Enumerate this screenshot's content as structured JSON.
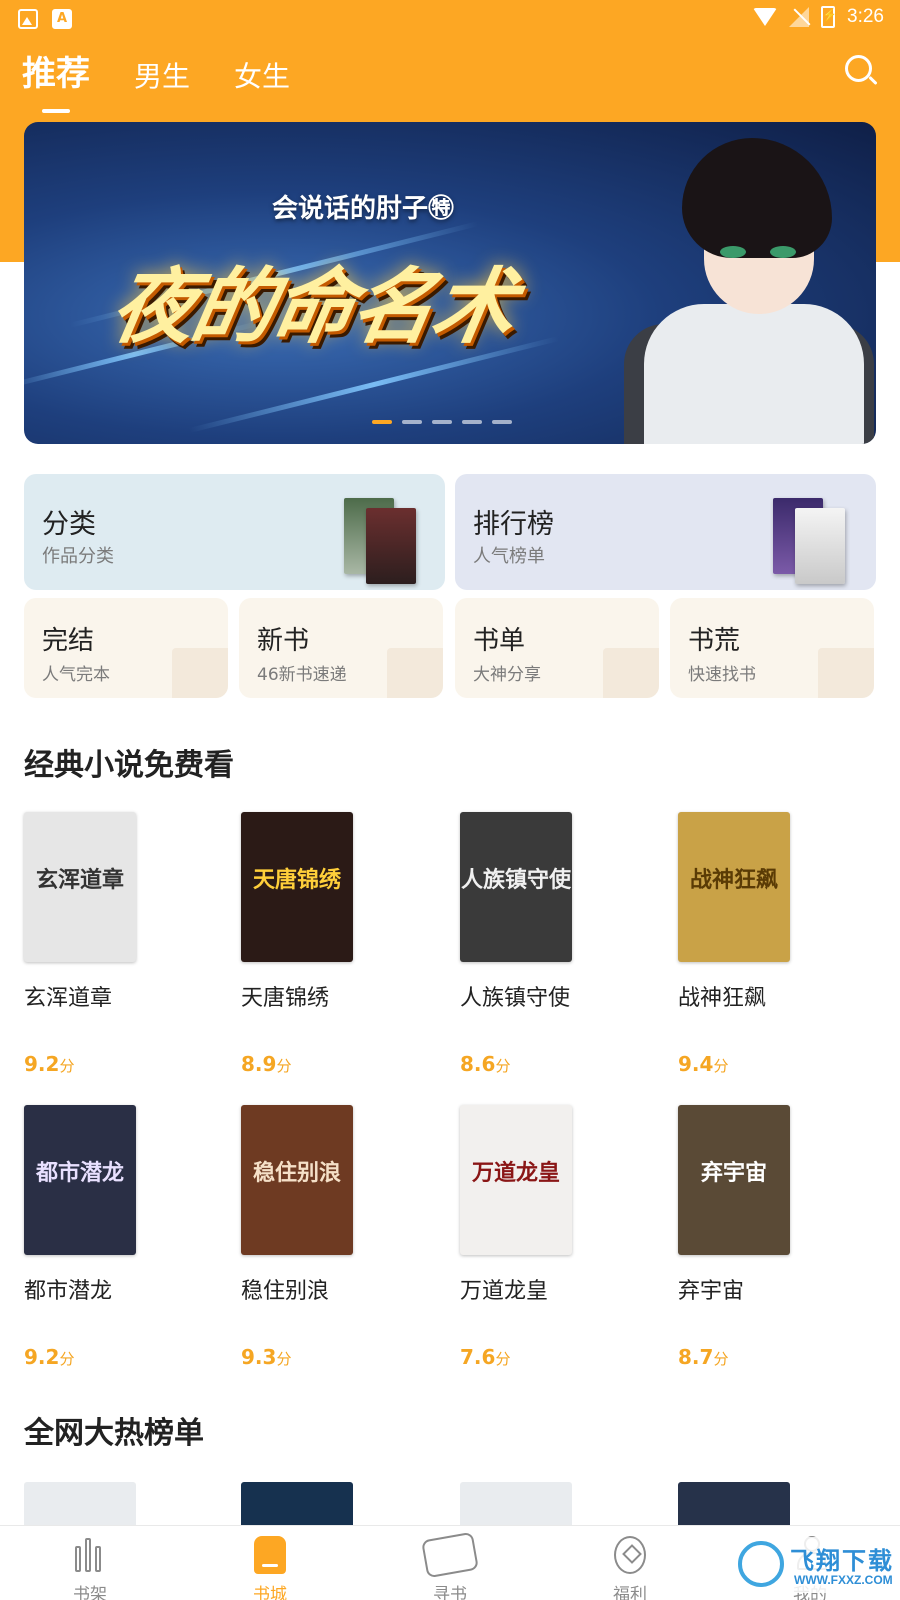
{
  "status_bar": {
    "time": "3:26",
    "notif_icon_letter": "A"
  },
  "header": {
    "tabs": [
      {
        "label": "推荐",
        "active": true
      },
      {
        "label": "男生",
        "active": false
      },
      {
        "label": "女生",
        "active": false
      }
    ],
    "search_icon": "search-icon"
  },
  "banner": {
    "author": "会说话的肘子㊕",
    "title": "夜的命名术",
    "slide_count": 5,
    "active_slide": 1
  },
  "quick_entries": {
    "large": [
      {
        "title": "分类",
        "subtitle": "作品分类"
      },
      {
        "title": "排行榜",
        "subtitle": "人气榜单"
      }
    ],
    "small": [
      {
        "title": "完结",
        "subtitle": "人气完本"
      },
      {
        "title": "新书",
        "subtitle": "46新书速递"
      },
      {
        "title": "书单",
        "subtitle": "大神分享"
      },
      {
        "title": "书荒",
        "subtitle": "快速找书"
      }
    ]
  },
  "sections": {
    "classics": {
      "title": "经典小说免费看",
      "books": [
        {
          "name": "玄浑道章",
          "score": "9.2",
          "unit": "分",
          "cover_text": "玄浑道章",
          "cover_bg": "#e6e6e6",
          "cover_fg": "#333333"
        },
        {
          "name": "天唐锦绣",
          "score": "8.9",
          "unit": "分",
          "cover_text": "天唐锦绣",
          "cover_bg": "#2b1a16",
          "cover_fg": "#ffcf3a"
        },
        {
          "name": "人族镇守使",
          "score": "8.6",
          "unit": "分",
          "cover_text": "人族镇守使",
          "cover_bg": "#3a3a3a",
          "cover_fg": "#f0f0f0"
        },
        {
          "name": "战神狂飙",
          "score": "9.4",
          "unit": "分",
          "cover_text": "战神狂飙",
          "cover_bg": "#c9a247",
          "cover_fg": "#5a3b05"
        },
        {
          "name": "都市潜龙",
          "score": "9.2",
          "unit": "分",
          "cover_text": "都市潜龙",
          "cover_bg": "#2a2f45",
          "cover_fg": "#e8e0ff"
        },
        {
          "name": "稳住别浪",
          "score": "9.3",
          "unit": "分",
          "cover_text": "稳住别浪",
          "cover_bg": "#6e3a22",
          "cover_fg": "#f5e0c8"
        },
        {
          "name": "万道龙皇",
          "score": "7.6",
          "unit": "分",
          "cover_text": "万道龙皇",
          "cover_bg": "#f2f0ee",
          "cover_fg": "#8a1616"
        },
        {
          "name": "弃宇宙",
          "score": "8.7",
          "unit": "分",
          "cover_text": "弃宇宙",
          "cover_bg": "#5a4a36",
          "cover_fg": "#ffffff"
        }
      ]
    },
    "hot_list": {
      "title": "全网大热榜单",
      "covers": [
        "#e9ecef",
        "#16314f",
        "#e9ecef",
        "#26324a"
      ]
    }
  },
  "bottom_nav": [
    {
      "label": "书架",
      "icon": "bookshelf-icon",
      "active": false
    },
    {
      "label": "书城",
      "icon": "bookstore-icon",
      "active": true
    },
    {
      "label": "寻书",
      "icon": "find-book-icon",
      "active": false
    },
    {
      "label": "福利",
      "icon": "benefits-icon",
      "active": false
    },
    {
      "label": "我的",
      "icon": "profile-icon",
      "active": false
    }
  ],
  "watermark": {
    "text": "飞翔下载",
    "url": "WWW.FXXZ.COM"
  },
  "colors": {
    "accent": "#fda723",
    "score": "#f5a623"
  }
}
